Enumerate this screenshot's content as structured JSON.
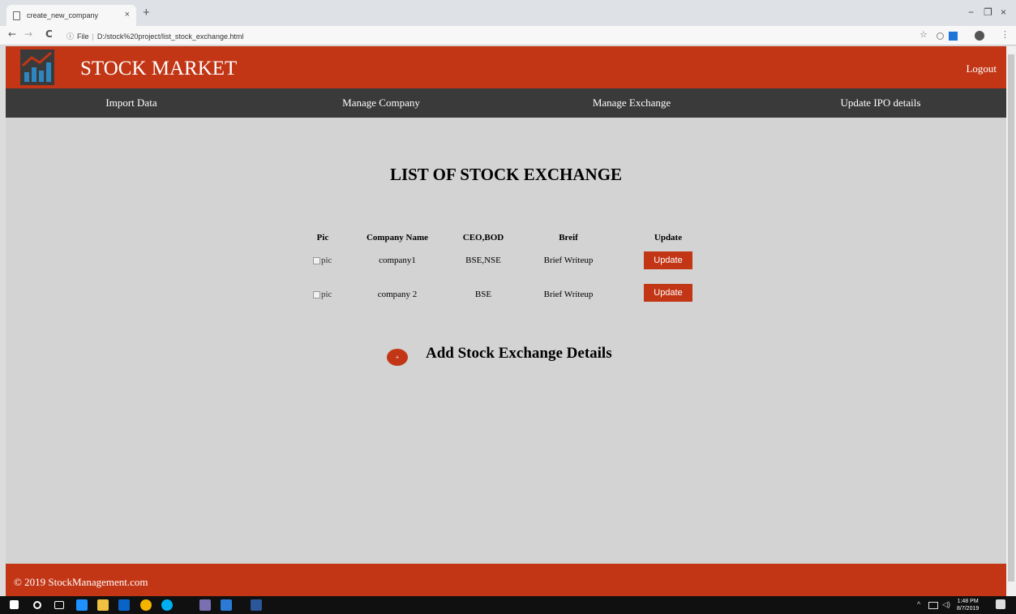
{
  "browser": {
    "tab_title": "create_new_company",
    "tab_close": "×",
    "new_tab": "+",
    "url_info": "ⓘ",
    "url_prefix": "File",
    "url_sep": "|",
    "url": "D:/stock%20project/list_stock_exchange.html",
    "back": "←",
    "forward": "→",
    "reload": "C",
    "minimize": "−",
    "restore": "❐",
    "close": "×",
    "bookmark_star": "☆"
  },
  "header": {
    "brand": "STOCK MARKET",
    "logout": "Logout"
  },
  "nav": {
    "items": [
      "Import Data",
      "Manage Company",
      "Manage Exchange",
      "Update IPO details"
    ]
  },
  "main": {
    "title": "LIST OF STOCK EXCHANGE",
    "columns": [
      "Pic",
      "Company Name",
      "CEO,BOD",
      "Breif",
      "Update"
    ],
    "rows": [
      {
        "pic": "pic",
        "company": "company1",
        "ceo": "BSE,NSE",
        "brief": "Brief Writeup",
        "update": "Update"
      },
      {
        "pic": "pic",
        "company": "company 2",
        "ceo": "BSE",
        "brief": "Brief Writeup",
        "update": "Update"
      }
    ],
    "add_icon": "+",
    "add_label": "Add Stock Exchange Details"
  },
  "footer": {
    "text": "© 2019 StockManagement.com"
  },
  "taskbar": {
    "time": "1:48 PM",
    "date": "8/7/2019",
    "tray": "^"
  },
  "colors": {
    "accent": "#c23616",
    "nav_bg": "#3a3a3a",
    "page_bg": "#d3d3d3"
  }
}
